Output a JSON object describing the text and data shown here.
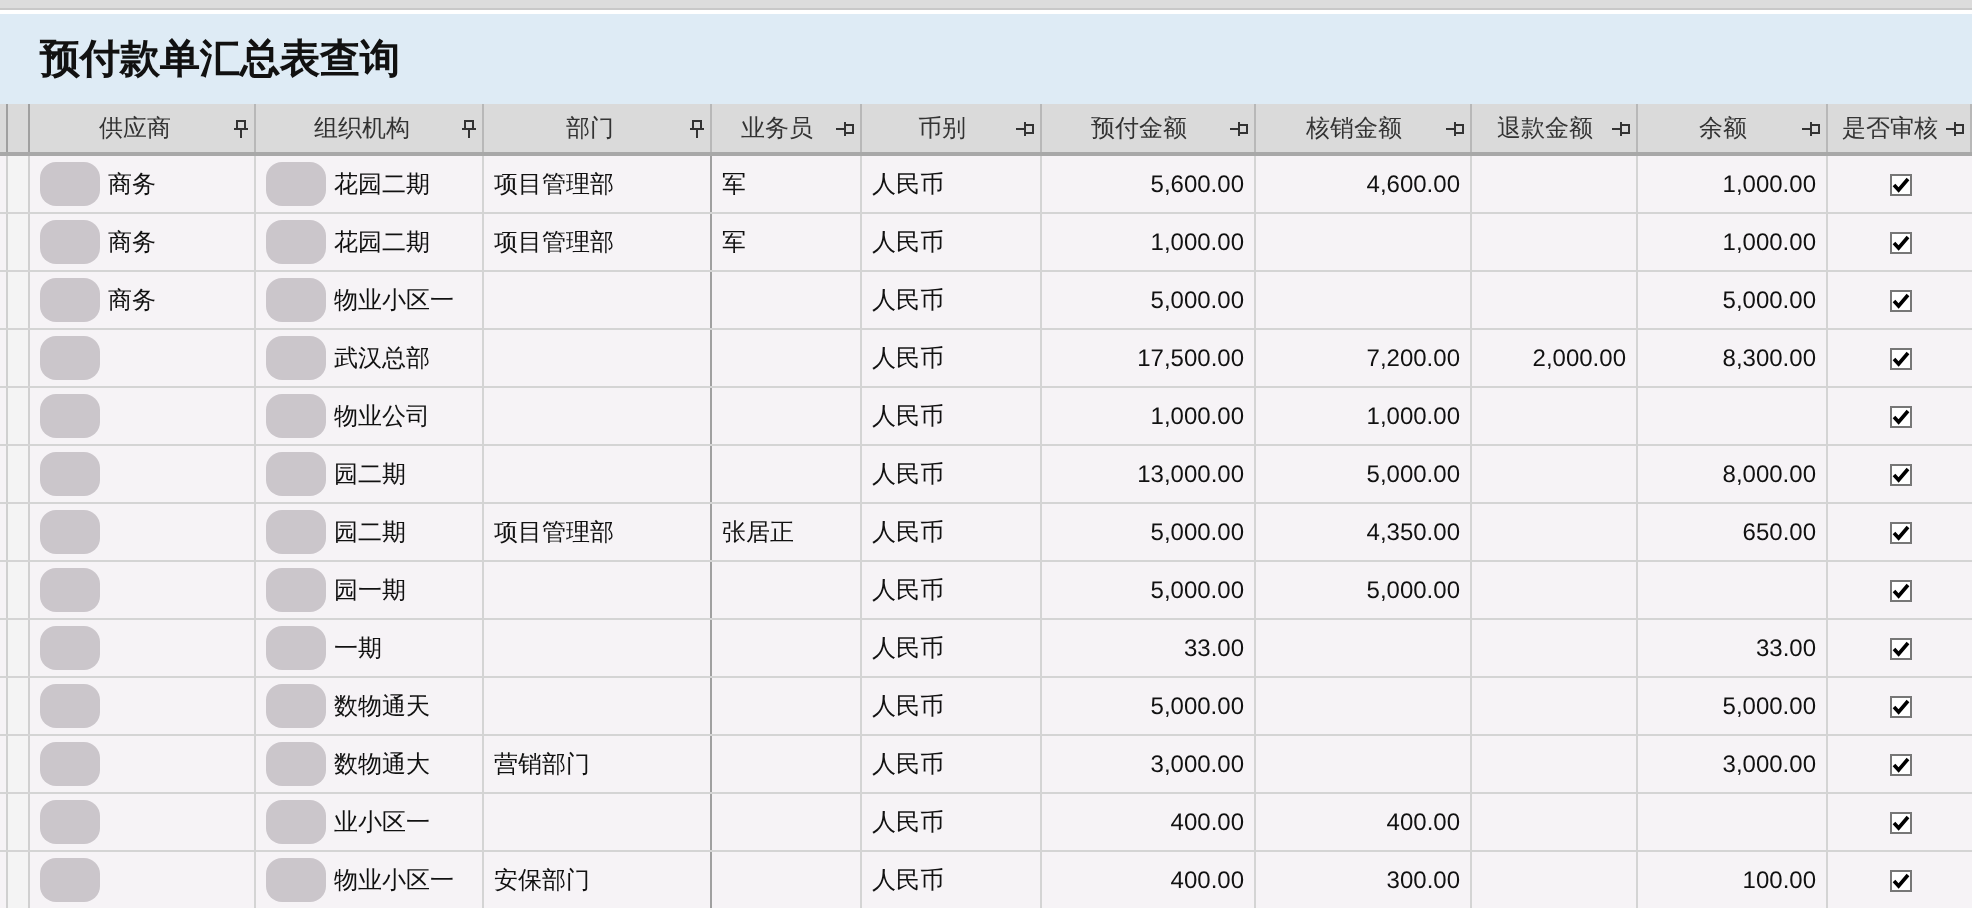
{
  "title": "预付款单汇总表查询",
  "table": {
    "columns": [
      {
        "label": "供应商",
        "pinned": true
      },
      {
        "label": "组织机构",
        "pinned": true
      },
      {
        "label": "部门",
        "pinned": true
      },
      {
        "label": "业务员",
        "pinned": false
      },
      {
        "label": "币别",
        "pinned": false
      },
      {
        "label": "预付金额",
        "pinned": false
      },
      {
        "label": "核销金额",
        "pinned": false
      },
      {
        "label": "退款金额",
        "pinned": false
      },
      {
        "label": "余额",
        "pinned": false
      },
      {
        "label": "是否审核",
        "pinned": false
      }
    ],
    "rows": [
      {
        "supplier": "商务",
        "org": "花园二期",
        "dept": "项目管理部",
        "clerk": "军",
        "currency": "人民币",
        "prepaid": "5,600.00",
        "writeoff": "4,600.00",
        "refund": "",
        "balance": "1,000.00",
        "audited": true
      },
      {
        "supplier": "商务",
        "org": "花园二期",
        "dept": "项目管理部",
        "clerk": "军",
        "currency": "人民币",
        "prepaid": "1,000.00",
        "writeoff": "",
        "refund": "",
        "balance": "1,000.00",
        "audited": true
      },
      {
        "supplier": "商务",
        "org": "物业小区一",
        "dept": "",
        "clerk": "",
        "currency": "人民币",
        "prepaid": "5,000.00",
        "writeoff": "",
        "refund": "",
        "balance": "5,000.00",
        "audited": true
      },
      {
        "supplier": "",
        "org": "武汉总部",
        "dept": "",
        "clerk": "",
        "currency": "人民币",
        "prepaid": "17,500.00",
        "writeoff": "7,200.00",
        "refund": "2,000.00",
        "balance": "8,300.00",
        "audited": true
      },
      {
        "supplier": "",
        "org": "物业公司",
        "dept": "",
        "clerk": "",
        "currency": "人民币",
        "prepaid": "1,000.00",
        "writeoff": "1,000.00",
        "refund": "",
        "balance": "",
        "audited": true
      },
      {
        "supplier": "",
        "org": "园二期",
        "dept": "",
        "clerk": "",
        "currency": "人民币",
        "prepaid": "13,000.00",
        "writeoff": "5,000.00",
        "refund": "",
        "balance": "8,000.00",
        "audited": true
      },
      {
        "supplier": "",
        "org": "园二期",
        "dept": "项目管理部",
        "clerk": "张居正",
        "currency": "人民币",
        "prepaid": "5,000.00",
        "writeoff": "4,350.00",
        "refund": "",
        "balance": "650.00",
        "audited": true
      },
      {
        "supplier": "",
        "org": "园一期",
        "dept": "",
        "clerk": "",
        "currency": "人民币",
        "prepaid": "5,000.00",
        "writeoff": "5,000.00",
        "refund": "",
        "balance": "",
        "audited": true
      },
      {
        "supplier": "",
        "org": "一期",
        "dept": "",
        "clerk": "",
        "currency": "人民币",
        "prepaid": "33.00",
        "writeoff": "",
        "refund": "",
        "balance": "33.00",
        "audited": true
      },
      {
        "supplier": "",
        "org": "数物通天",
        "dept": "",
        "clerk": "",
        "currency": "人民币",
        "prepaid": "5,000.00",
        "writeoff": "",
        "refund": "",
        "balance": "5,000.00",
        "audited": true
      },
      {
        "supplier": "",
        "org": "数物通大",
        "dept": "营销部门",
        "clerk": "",
        "currency": "人民币",
        "prepaid": "3,000.00",
        "writeoff": "",
        "refund": "",
        "balance": "3,000.00",
        "audited": true
      },
      {
        "supplier": "",
        "org": "业小区一",
        "dept": "",
        "clerk": "",
        "currency": "人民币",
        "prepaid": "400.00",
        "writeoff": "400.00",
        "refund": "",
        "balance": "",
        "audited": true
      },
      {
        "supplier": "",
        "org": "物业小区一",
        "dept": "安保部门",
        "clerk": "",
        "currency": "人民币",
        "prepaid": "400.00",
        "writeoff": "300.00",
        "refund": "",
        "balance": "100.00",
        "audited": true
      }
    ]
  }
}
